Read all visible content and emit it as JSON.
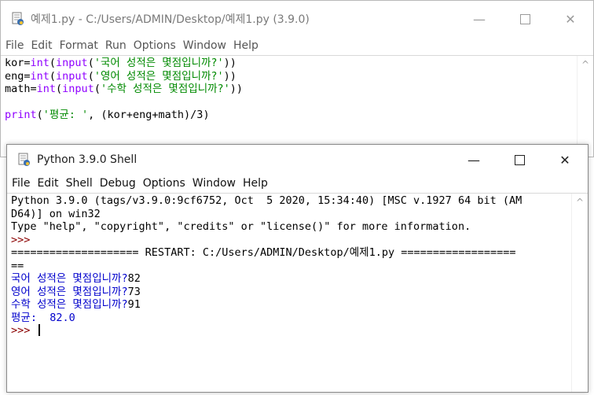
{
  "editor": {
    "title": "예제1.py - C:/Users/ADMIN/Desktop/예제1.py (3.9.0)",
    "controls": {
      "minimize": "—",
      "close": "✕"
    },
    "menu": [
      "File",
      "Edit",
      "Format",
      "Run",
      "Options",
      "Window",
      "Help"
    ],
    "code": [
      {
        "p1": "kor=",
        "f1": "int",
        "p2": "(",
        "f2": "input",
        "p3": "(",
        "s": "'국어 성적은 몇점입니까?'",
        "p4": "))"
      },
      {
        "p1": "eng=",
        "f1": "int",
        "p2": "(",
        "f2": "input",
        "p3": "(",
        "s": "'영어 성적은 몇점입니까?'",
        "p4": "))"
      },
      {
        "p1": "math=",
        "f1": "int",
        "p2": "(",
        "f2": "input",
        "p3": "(",
        "s": "'수학 성적은 몇점입니까?'",
        "p4": "))"
      }
    ],
    "print_line": {
      "f": "print",
      "p1": "(",
      "s": "'평균: '",
      "rest": ", (kor+eng+math)/3)"
    }
  },
  "shell": {
    "title": "Python 3.9.0 Shell",
    "controls": {
      "minimize": "—",
      "close": "✕"
    },
    "menu": [
      "File",
      "Edit",
      "Shell",
      "Debug",
      "Options",
      "Window",
      "Help"
    ],
    "lines": {
      "l1": "Python 3.9.0 (tags/v3.9.0:9cf6752, Oct  5 2020, 15:34:40) [MSC v.1927 64 bit (AM",
      "l2": "D64)] on win32",
      "l3": "Type \"help\", \"copyright\", \"credits\" or \"license()\" for more information.",
      "prompt1": ">>> ",
      "restart": "==================== RESTART: C:/Users/ADMIN/Desktop/예제1.py ==================",
      "restart2": "==",
      "q1": "국어 성적은 몇점입니까?",
      "a1": "82",
      "q2": "영어 성적은 몇점입니까?",
      "a2": "73",
      "q3": "수학 성적은 몇점입니까?",
      "a3": "91",
      "avg": "평균:  82.0",
      "prompt2": ">>> "
    }
  },
  "colors": {
    "keyword": "#8f00ff",
    "string": "#008a00",
    "output": "#0000cc",
    "prompt": "#8b0000"
  },
  "icons": {
    "app": "python-idle-icon",
    "scroll_up": "chevron-up-icon"
  }
}
